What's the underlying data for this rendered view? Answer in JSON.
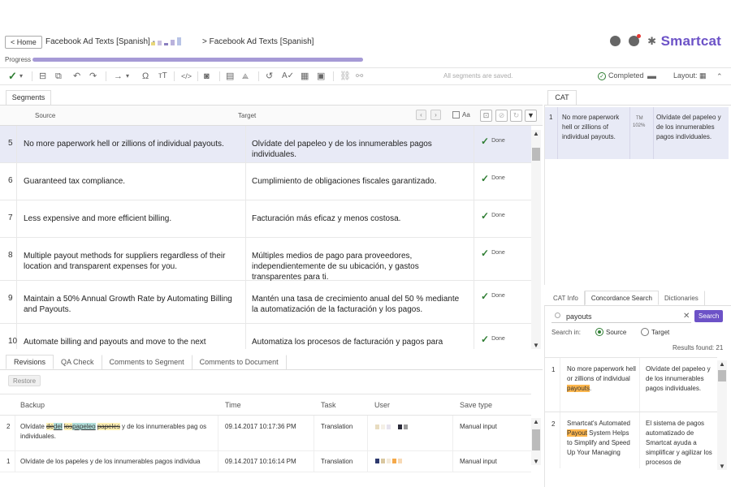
{
  "header": {
    "home_label": "< Home",
    "doc_title": "Facebook Ad Texts [Spanish] -",
    "breadcrumb": "> Facebook Ad Texts [Spanish]",
    "logo": "Smartcat",
    "brand_color": "#6c52c7"
  },
  "progress": {
    "label": "Progress",
    "value": 100
  },
  "toolbar": {
    "save_message": "All segments are saved.",
    "completed_label": "Completed",
    "layout_label": "Layout:"
  },
  "segments": {
    "tab_label": "Segments",
    "col_source": "Source",
    "col_target": "Target",
    "aa_label": "Aa",
    "rows": [
      {
        "num": "5",
        "source": "No more paperwork hell or zillions of individual payouts.",
        "target": "Olvídate del papeleo y de los innumerables pagos individuales.",
        "status": "Done",
        "active": true
      },
      {
        "num": "6",
        "source": "Guaranteed tax compliance.",
        "target": "Cumplimiento de obligaciones fiscales garantizado.",
        "status": "Done"
      },
      {
        "num": "7",
        "source": "Less expensive and more efficient billing.",
        "target": "Facturación más eficaz y menos costosa.",
        "status": "Done"
      },
      {
        "num": "8",
        "source": "Multiple payout methods for suppliers regardless of their location and transparent expenses for you.",
        "target": "Múltiples medios de pago para proveedores, independientemente de su ubicación, y gastos transparentes para ti.",
        "status": "Done"
      },
      {
        "num": "9",
        "source": "Maintain a 50% Annual Growth Rate by Automating Billing and Payouts.",
        "target": "Mantén una tasa de crecimiento anual del 50 % mediante la automatización de la facturación y los pagos.",
        "status": "Done"
      },
      {
        "num": "10",
        "source": "Automate billing and payouts and move to the next",
        "target": "Automatiza los procesos de facturación y pagos para",
        "status": "Done"
      }
    ]
  },
  "bottom": {
    "tabs": [
      "Revisions",
      "QA Check",
      "Comments to Segment",
      "Comments to Document"
    ],
    "restore_label": "Restore",
    "columns": [
      "Backup",
      "Time",
      "Task",
      "User",
      "Save type"
    ],
    "rows": [
      {
        "num": "2",
        "backup_a": "Olvídate ",
        "del_1": "de",
        "ins_1": "del",
        "sp": " ",
        "del_2": "los",
        "ins_2": "papeleo",
        "sp2": " ",
        "del_3": "papeles",
        "backup_b": " y de los innumerables pag os individuales.",
        "time": "09.14.2017 10:17:36 PM",
        "task": "Translation",
        "save_type": "Manual input"
      },
      {
        "num": "1",
        "backup": "Olvídate de los papeles y de los innumerables pagos individua",
        "time": "09.14.2017 10:16:14 PM",
        "task": "Translation",
        "save_type": "Manual input"
      }
    ]
  },
  "cat": {
    "tab_label": "CAT",
    "match": {
      "num": "1",
      "source": "No more paperwork hell or zillions of individual payouts.",
      "tm": "TM",
      "percent": "102%",
      "target": "Olvídate del papeleo y de los innumerables pagos individuales."
    }
  },
  "concordance": {
    "tabs": [
      "CAT Info",
      "Concordance Search",
      "Dictionaries"
    ],
    "query": "payouts",
    "search_button": "Search",
    "search_in_label": "Search in:",
    "radio_source": "Source",
    "radio_target": "Target",
    "results_found": "Results found: 21",
    "results": [
      {
        "num": "1",
        "source_pre": "No more paperwork hell or zillions of individual ",
        "source_hl": "payouts",
        "source_post": ".",
        "target": "Olvídate del papeleo y de los innumerables pagos individuales."
      },
      {
        "num": "2",
        "source_pre": "Smartcat's Automated ",
        "source_hl": "Payout",
        "source_post": " System Helps to Simplify and Speed Up Your Managing",
        "target": "El sistema de pagos automatizado de Smartcat ayuda a simplificar y agilizar los procesos de"
      }
    ]
  }
}
